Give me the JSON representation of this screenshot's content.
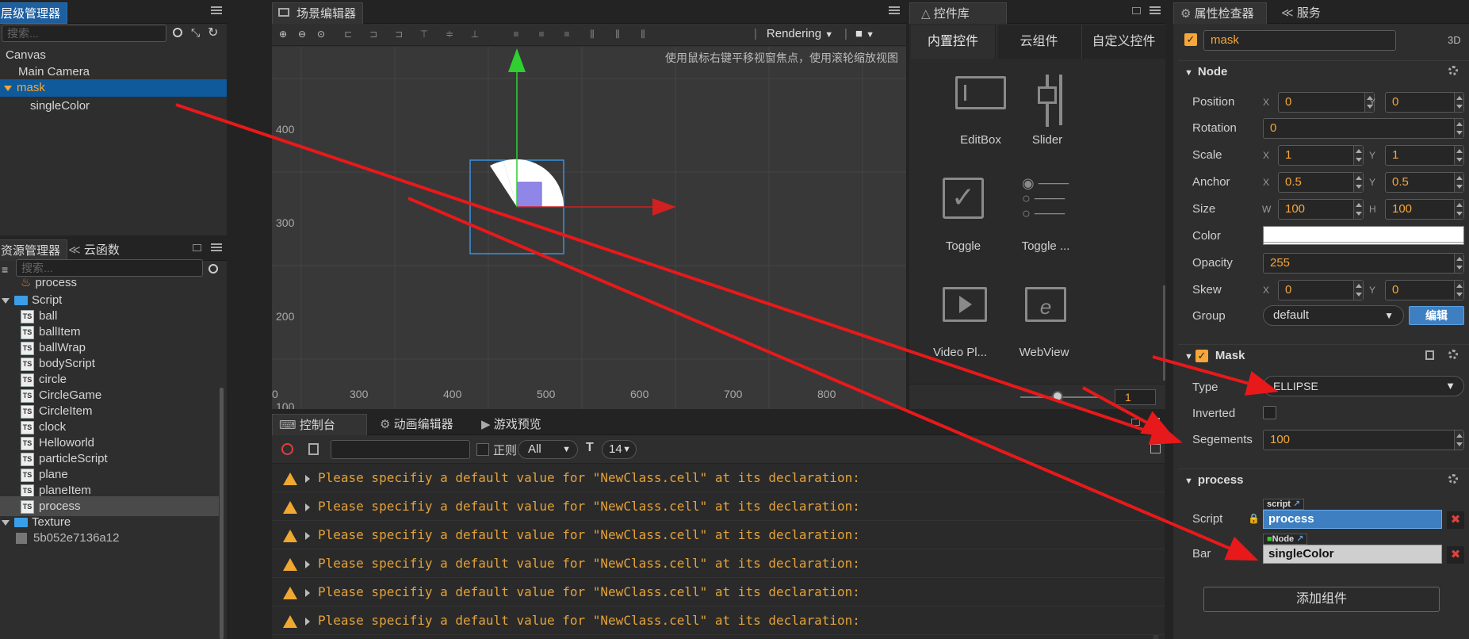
{
  "hierarchy": {
    "tab": "层级管理器",
    "search_placeholder": "搜索...",
    "items": [
      {
        "label": "Canvas"
      },
      {
        "label": "Main Camera"
      },
      {
        "label": "mask"
      },
      {
        "label": "singleColor"
      }
    ]
  },
  "assets": {
    "tabs": [
      "资源管理器",
      "云函数"
    ],
    "search_placeholder": "搜索...",
    "items": [
      {
        "label": "process"
      },
      {
        "label": "Script"
      },
      {
        "label": "ball"
      },
      {
        "label": "ballItem"
      },
      {
        "label": "ballWrap"
      },
      {
        "label": "bodyScript"
      },
      {
        "label": "circle"
      },
      {
        "label": "CircleGame"
      },
      {
        "label": "CircleItem"
      },
      {
        "label": "clock"
      },
      {
        "label": "Helloworld"
      },
      {
        "label": "particleScript"
      },
      {
        "label": "plane"
      },
      {
        "label": "planeItem"
      },
      {
        "label": "process"
      },
      {
        "label": "Texture"
      },
      {
        "label": "5b052e7136a12"
      }
    ],
    "ts_badge": "TS"
  },
  "scene": {
    "tab": "场景编辑器",
    "rendering": "Rendering",
    "hint": "使用鼠标右键平移视窗焦点，使用滚轮缩放视图",
    "y_labels": [
      "400",
      "300",
      "200",
      "100"
    ],
    "x_labels": [
      "0",
      "300",
      "400",
      "500",
      "600",
      "700",
      "800"
    ]
  },
  "console": {
    "tabs": [
      "控制台",
      "动画编辑器",
      "游戏预览"
    ],
    "regex_label": "正则",
    "level_select": "All",
    "font_size": "14",
    "messages": [
      "Please specifiy a default value for \"NewClass.cell\" at its declaration:",
      "Please specifiy a default value for \"NewClass.cell\" at its declaration:",
      "Please specifiy a default value for \"NewClass.cell\" at its declaration:",
      "Please specifiy a default value for \"NewClass.cell\" at its declaration:",
      "Please specifiy a default value for \"NewClass.cell\" at its declaration:",
      "Please specifiy a default value for \"NewClass.cell\" at its declaration:"
    ]
  },
  "library": {
    "tab": "控件库",
    "subtabs": [
      "内置控件",
      "云组件",
      "自定义控件"
    ],
    "widgets": [
      "EditBox",
      "Slider",
      "Toggle",
      "Toggle ...",
      "Video Pl...",
      "WebView"
    ],
    "zoom_value": "1"
  },
  "inspector": {
    "tabs": [
      "属性检查器",
      "服务"
    ],
    "node_name": "mask",
    "mode_3d": "3D",
    "node_section": "Node",
    "props": {
      "position_label": "Position",
      "pos_x": "0",
      "pos_y": "0",
      "rotation_label": "Rotation",
      "rotation": "0",
      "scale_label": "Scale",
      "scale_x": "1",
      "scale_y": "1",
      "anchor_label": "Anchor",
      "anchor_x": "0.5",
      "anchor_y": "0.5",
      "size_label": "Size",
      "size_w": "100",
      "size_h": "100",
      "color_label": "Color",
      "opacity_label": "Opacity",
      "opacity": "255",
      "skew_label": "Skew",
      "skew_x": "0",
      "skew_y": "0",
      "group_label": "Group",
      "group": "default",
      "edit_button": "编辑"
    },
    "axis": {
      "x": "X",
      "y": "Y",
      "w": "W",
      "h": "H"
    },
    "mask_section": "Mask",
    "mask": {
      "type_label": "Type",
      "type": "ELLIPSE",
      "inverted_label": "Inverted",
      "segments_label": "Segements",
      "segments": "100"
    },
    "process_section": "process",
    "process": {
      "script_label": "Script",
      "script_tag": "script",
      "script": "process",
      "bar_label": "Bar",
      "bar_tag": "Node",
      "bar": "singleColor"
    },
    "add_component": "添加组件",
    "colors": {
      "accent": "#f6a63a",
      "selection": "#0e5a9b",
      "field_blue": "#3d7fc1",
      "arrow": "#e8191b"
    }
  }
}
